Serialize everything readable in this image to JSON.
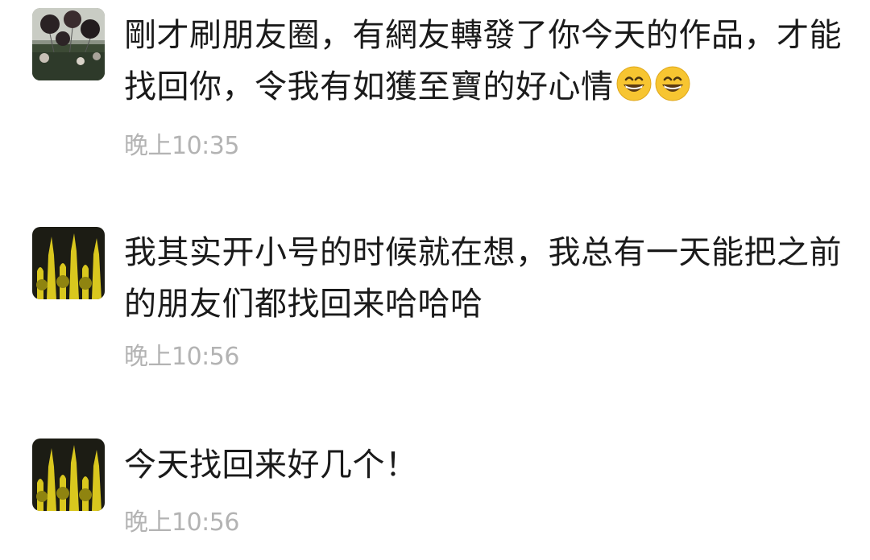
{
  "messages": [
    {
      "avatar_icon": "balloons-crowd-avatar",
      "text": "剛才刷朋友圈，有網友轉發了你今天的作品，才能找回你，令我有如獲至寶的好心情",
      "emojis": [
        "grinning-face-emoji",
        "grinning-face-emoji"
      ],
      "time": "晚上10:35"
    },
    {
      "avatar_icon": "yellow-figures-avatar",
      "text": "我其实开小号的时候就在想，我总有一天能把之前的朋友们都找回来哈哈哈",
      "emojis": [],
      "time": "晚上10:56"
    },
    {
      "avatar_icon": "yellow-figures-avatar",
      "text": "今天找回来好几个！",
      "emojis": [],
      "time": "晚上10:56"
    }
  ],
  "colors": {
    "text": "#1a1a1a",
    "timestamp": "#b3b3b3",
    "background": "#ffffff",
    "emoji_face": "#f7c531"
  }
}
